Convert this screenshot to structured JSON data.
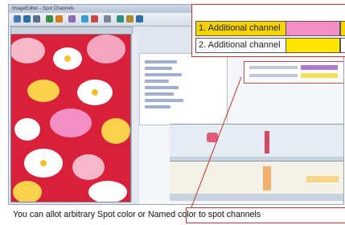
{
  "window": {
    "title": "ImageEditor - Spot Channels"
  },
  "toolbar": {
    "icons": [
      "open-icon",
      "save-icon",
      "print-icon",
      "undo-icon",
      "redo-icon",
      "zoom-icon",
      "layers-icon",
      "channels-icon"
    ]
  },
  "overlay": {
    "rows": [
      {
        "label": "1. Additional channel",
        "label_bg": "#f6d200",
        "swatch": "#f48fc6"
      },
      {
        "label": "2. Additional channel",
        "label_bg": "#ffffff",
        "swatch": "#ffe600"
      }
    ]
  },
  "caption": {
    "text": "You can allot arbitrary Spot color or Named color to spot channels"
  },
  "colors": {
    "accent": "#c0392b",
    "canvas_bg": "#d9203b"
  }
}
